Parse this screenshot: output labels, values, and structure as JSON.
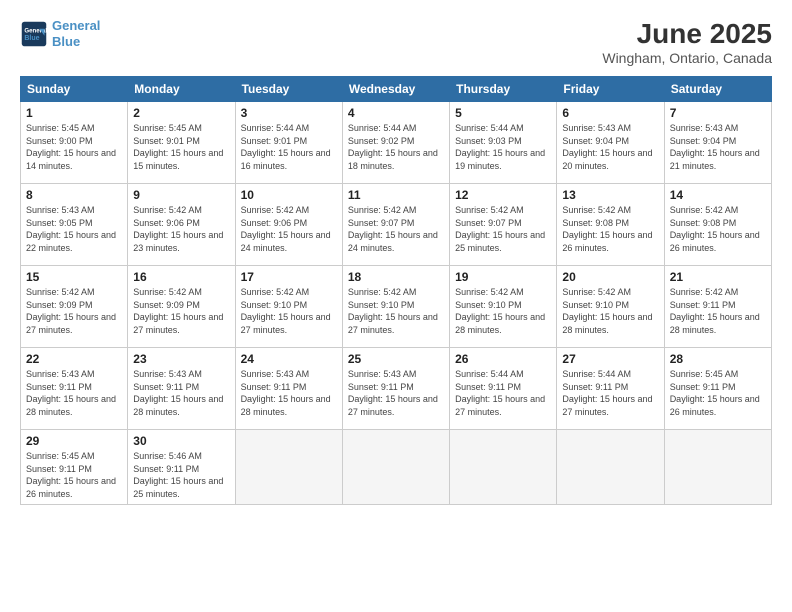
{
  "logo": {
    "line1": "General",
    "line2": "Blue"
  },
  "title": "June 2025",
  "location": "Wingham, Ontario, Canada",
  "weekdays": [
    "Sunday",
    "Monday",
    "Tuesday",
    "Wednesday",
    "Thursday",
    "Friday",
    "Saturday"
  ],
  "weeks": [
    [
      {
        "day": "1",
        "sunrise": "Sunrise: 5:45 AM",
        "sunset": "Sunset: 9:00 PM",
        "daylight": "Daylight: 15 hours and 14 minutes."
      },
      {
        "day": "2",
        "sunrise": "Sunrise: 5:45 AM",
        "sunset": "Sunset: 9:01 PM",
        "daylight": "Daylight: 15 hours and 15 minutes."
      },
      {
        "day": "3",
        "sunrise": "Sunrise: 5:44 AM",
        "sunset": "Sunset: 9:01 PM",
        "daylight": "Daylight: 15 hours and 16 minutes."
      },
      {
        "day": "4",
        "sunrise": "Sunrise: 5:44 AM",
        "sunset": "Sunset: 9:02 PM",
        "daylight": "Daylight: 15 hours and 18 minutes."
      },
      {
        "day": "5",
        "sunrise": "Sunrise: 5:44 AM",
        "sunset": "Sunset: 9:03 PM",
        "daylight": "Daylight: 15 hours and 19 minutes."
      },
      {
        "day": "6",
        "sunrise": "Sunrise: 5:43 AM",
        "sunset": "Sunset: 9:04 PM",
        "daylight": "Daylight: 15 hours and 20 minutes."
      },
      {
        "day": "7",
        "sunrise": "Sunrise: 5:43 AM",
        "sunset": "Sunset: 9:04 PM",
        "daylight": "Daylight: 15 hours and 21 minutes."
      }
    ],
    [
      {
        "day": "8",
        "sunrise": "Sunrise: 5:43 AM",
        "sunset": "Sunset: 9:05 PM",
        "daylight": "Daylight: 15 hours and 22 minutes."
      },
      {
        "day": "9",
        "sunrise": "Sunrise: 5:42 AM",
        "sunset": "Sunset: 9:06 PM",
        "daylight": "Daylight: 15 hours and 23 minutes."
      },
      {
        "day": "10",
        "sunrise": "Sunrise: 5:42 AM",
        "sunset": "Sunset: 9:06 PM",
        "daylight": "Daylight: 15 hours and 24 minutes."
      },
      {
        "day": "11",
        "sunrise": "Sunrise: 5:42 AM",
        "sunset": "Sunset: 9:07 PM",
        "daylight": "Daylight: 15 hours and 24 minutes."
      },
      {
        "day": "12",
        "sunrise": "Sunrise: 5:42 AM",
        "sunset": "Sunset: 9:07 PM",
        "daylight": "Daylight: 15 hours and 25 minutes."
      },
      {
        "day": "13",
        "sunrise": "Sunrise: 5:42 AM",
        "sunset": "Sunset: 9:08 PM",
        "daylight": "Daylight: 15 hours and 26 minutes."
      },
      {
        "day": "14",
        "sunrise": "Sunrise: 5:42 AM",
        "sunset": "Sunset: 9:08 PM",
        "daylight": "Daylight: 15 hours and 26 minutes."
      }
    ],
    [
      {
        "day": "15",
        "sunrise": "Sunrise: 5:42 AM",
        "sunset": "Sunset: 9:09 PM",
        "daylight": "Daylight: 15 hours and 27 minutes."
      },
      {
        "day": "16",
        "sunrise": "Sunrise: 5:42 AM",
        "sunset": "Sunset: 9:09 PM",
        "daylight": "Daylight: 15 hours and 27 minutes."
      },
      {
        "day": "17",
        "sunrise": "Sunrise: 5:42 AM",
        "sunset": "Sunset: 9:10 PM",
        "daylight": "Daylight: 15 hours and 27 minutes."
      },
      {
        "day": "18",
        "sunrise": "Sunrise: 5:42 AM",
        "sunset": "Sunset: 9:10 PM",
        "daylight": "Daylight: 15 hours and 27 minutes."
      },
      {
        "day": "19",
        "sunrise": "Sunrise: 5:42 AM",
        "sunset": "Sunset: 9:10 PM",
        "daylight": "Daylight: 15 hours and 28 minutes."
      },
      {
        "day": "20",
        "sunrise": "Sunrise: 5:42 AM",
        "sunset": "Sunset: 9:10 PM",
        "daylight": "Daylight: 15 hours and 28 minutes."
      },
      {
        "day": "21",
        "sunrise": "Sunrise: 5:42 AM",
        "sunset": "Sunset: 9:11 PM",
        "daylight": "Daylight: 15 hours and 28 minutes."
      }
    ],
    [
      {
        "day": "22",
        "sunrise": "Sunrise: 5:43 AM",
        "sunset": "Sunset: 9:11 PM",
        "daylight": "Daylight: 15 hours and 28 minutes."
      },
      {
        "day": "23",
        "sunrise": "Sunrise: 5:43 AM",
        "sunset": "Sunset: 9:11 PM",
        "daylight": "Daylight: 15 hours and 28 minutes."
      },
      {
        "day": "24",
        "sunrise": "Sunrise: 5:43 AM",
        "sunset": "Sunset: 9:11 PM",
        "daylight": "Daylight: 15 hours and 28 minutes."
      },
      {
        "day": "25",
        "sunrise": "Sunrise: 5:43 AM",
        "sunset": "Sunset: 9:11 PM",
        "daylight": "Daylight: 15 hours and 27 minutes."
      },
      {
        "day": "26",
        "sunrise": "Sunrise: 5:44 AM",
        "sunset": "Sunset: 9:11 PM",
        "daylight": "Daylight: 15 hours and 27 minutes."
      },
      {
        "day": "27",
        "sunrise": "Sunrise: 5:44 AM",
        "sunset": "Sunset: 9:11 PM",
        "daylight": "Daylight: 15 hours and 27 minutes."
      },
      {
        "day": "28",
        "sunrise": "Sunrise: 5:45 AM",
        "sunset": "Sunset: 9:11 PM",
        "daylight": "Daylight: 15 hours and 26 minutes."
      }
    ],
    [
      {
        "day": "29",
        "sunrise": "Sunrise: 5:45 AM",
        "sunset": "Sunset: 9:11 PM",
        "daylight": "Daylight: 15 hours and 26 minutes."
      },
      {
        "day": "30",
        "sunrise": "Sunrise: 5:46 AM",
        "sunset": "Sunset: 9:11 PM",
        "daylight": "Daylight: 15 hours and 25 minutes."
      },
      null,
      null,
      null,
      null,
      null
    ]
  ]
}
